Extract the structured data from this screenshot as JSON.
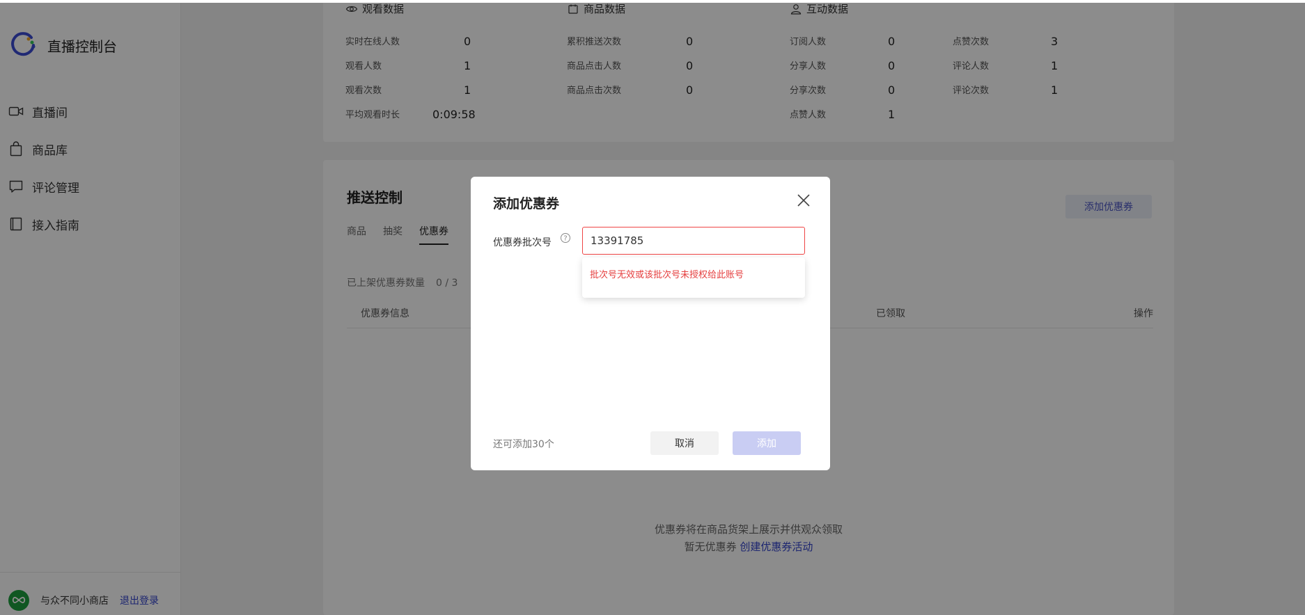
{
  "app": {
    "title": "直播控制台"
  },
  "sidebar": {
    "items": [
      {
        "label": "直播间",
        "icon": "video-camera-icon"
      },
      {
        "label": "商品库",
        "icon": "shopping-bag-icon"
      },
      {
        "label": "评论管理",
        "icon": "comment-icon"
      },
      {
        "label": "接入指南",
        "icon": "book-icon"
      }
    ],
    "footer": {
      "shop_name": "与众不同小商店",
      "logout": "退出登录"
    }
  },
  "stats": {
    "watch": {
      "title": "观看数据",
      "items": [
        {
          "label": "实时在线人数",
          "value": "0"
        },
        {
          "label": "观看人数",
          "value": "1"
        },
        {
          "label": "观看次数",
          "value": "1"
        },
        {
          "label": "平均观看时长",
          "value": "0:09:58"
        }
      ]
    },
    "goods": {
      "title": "商品数据",
      "items": [
        {
          "label": "累积推送次数",
          "value": "0"
        },
        {
          "label": "商品点击人数",
          "value": "0"
        },
        {
          "label": "商品点击次数",
          "value": "0"
        }
      ]
    },
    "interact": {
      "title": "互动数据",
      "items": [
        {
          "label": "订阅人数",
          "value": "0"
        },
        {
          "label": "分享人数",
          "value": "0"
        },
        {
          "label": "分享次数",
          "value": "0"
        },
        {
          "label": "点赞人数",
          "value": "1"
        },
        {
          "label": "点赞次数",
          "value": "3"
        },
        {
          "label": "评论人数",
          "value": "1"
        },
        {
          "label": "评论次数",
          "value": "1"
        }
      ]
    }
  },
  "push": {
    "title": "推送控制",
    "tabs": [
      {
        "label": "商品",
        "active": false
      },
      {
        "label": "抽奖",
        "active": false
      },
      {
        "label": "优惠券",
        "active": true
      }
    ],
    "add_button": "添加优惠券",
    "coupon_count_label": "已上架优惠券数量",
    "coupon_count": "0 / 3",
    "table": {
      "col_info": "优惠券信息",
      "col_claimed": "已领取",
      "col_action": "操作"
    },
    "empty": {
      "line1": "优惠券将在商品货架上展示并供观众领取",
      "line2_prefix": "暂无优惠券",
      "create_link": "创建优惠券活动"
    }
  },
  "modal": {
    "title": "添加优惠券",
    "field_label": "优惠券批次号",
    "input_value": "13391785",
    "error": "批次号无效或该批次号未授权给此账号",
    "remaining": "还可添加30个",
    "cancel": "取消",
    "confirm": "添加"
  },
  "colors": {
    "accent": "#3344cc",
    "error": "#e53e3e",
    "disabled_button": "#c9cdf3",
    "shop_avatar": "#1e9e3e"
  }
}
